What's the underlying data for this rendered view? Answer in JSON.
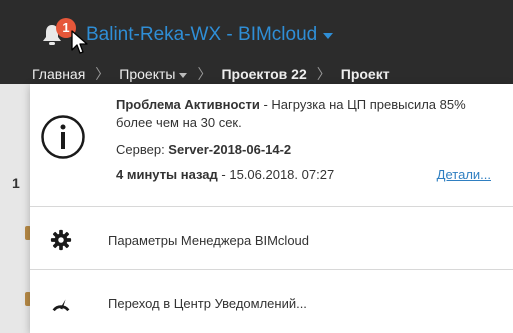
{
  "header": {
    "notification_count": "1",
    "server_name": "Balint-Reka-WX - BIMcloud"
  },
  "breadcrumbs": [
    {
      "label": "Главная"
    },
    {
      "label": "Проекты"
    },
    {
      "label": "Проектов 22"
    },
    {
      "label": "Проект"
    }
  ],
  "background": {
    "left_number": "1"
  },
  "notification": {
    "title": "Проблема Активности",
    "message": " - Нагрузка на ЦП превысила 85% более чем на 30 сек.",
    "server_label": "Сервер: ",
    "server_value": "Server-2018-06-14-2",
    "time_ago": "4 минуты назад",
    "timestamp": " - 15.06.2018. 07:27",
    "details_link": "Детали..."
  },
  "menu": {
    "settings_label": "Параметры Менеджера BIMcloud",
    "notification_center_label": "Переход в Центр Уведомлений..."
  },
  "colors": {
    "accent": "#2f8ed6",
    "badge": "#e6573a",
    "header_bg": "#2c2c2c"
  }
}
